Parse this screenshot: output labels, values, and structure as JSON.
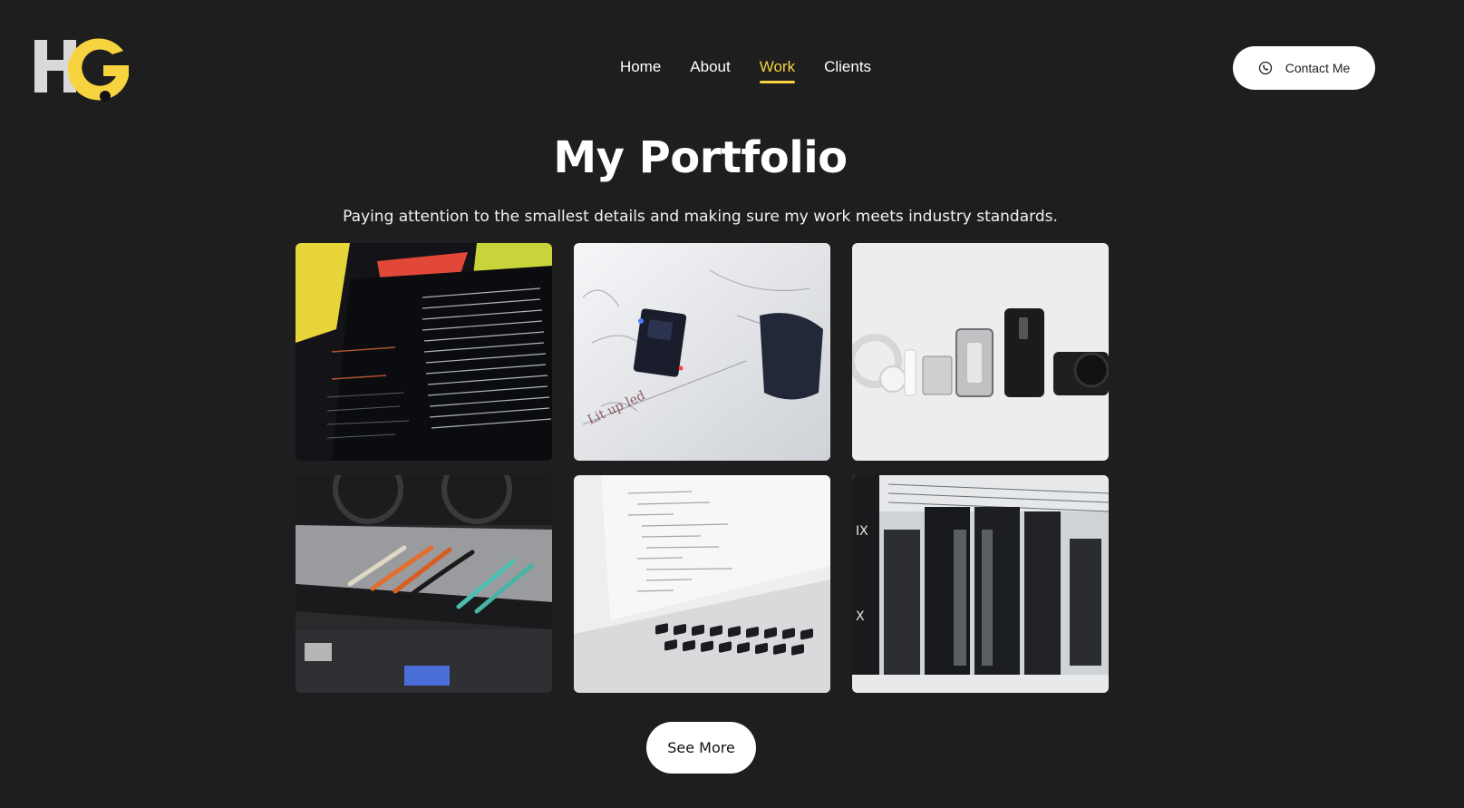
{
  "header": {
    "logo_text": "HG",
    "nav": [
      {
        "label": "Home",
        "active": false
      },
      {
        "label": "About",
        "active": false
      },
      {
        "label": "Work",
        "active": true
      },
      {
        "label": "Clients",
        "active": false
      }
    ],
    "contact_label": "Contact Me"
  },
  "main": {
    "title": "My Portfolio",
    "subtitle": "Paying attention to the smallest details and making sure my work meets industry standards.",
    "see_more_label": "See More",
    "tiles": [
      {
        "icon": "terminal-screen-photo"
      },
      {
        "icon": "circuit-board-photo"
      },
      {
        "icon": "devices-flatlay-photo"
      },
      {
        "icon": "network-switch-photo"
      },
      {
        "icon": "laptop-code-photo"
      },
      {
        "icon": "server-room-photo"
      }
    ]
  },
  "colors": {
    "background": "#1e1e1e",
    "accent": "#f7d33f",
    "text": "#ffffff"
  }
}
